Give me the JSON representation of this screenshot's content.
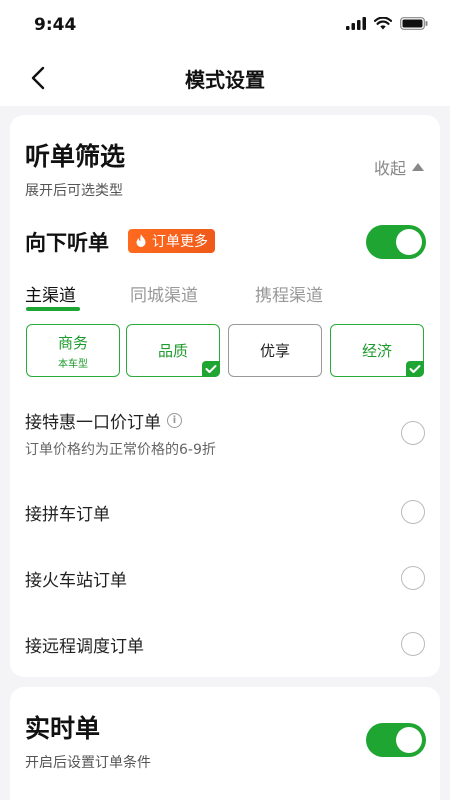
{
  "status": {
    "time": "9:44"
  },
  "nav": {
    "title": "模式设置"
  },
  "filter": {
    "title": "听单筛选",
    "subtitle": "展开后可选类型",
    "collapse_label": "收起"
  },
  "down_listen": {
    "title": "向下听单",
    "badge": "订单更多",
    "enabled": true
  },
  "tabs": [
    {
      "label": "主渠道",
      "active": true
    },
    {
      "label": "同城渠道",
      "active": false
    },
    {
      "label": "携程渠道",
      "active": false
    }
  ],
  "car_types": [
    {
      "label": "商务",
      "sub": "本车型",
      "selected": true,
      "checked": false
    },
    {
      "label": "品质",
      "sub": "",
      "selected": true,
      "checked": true
    },
    {
      "label": "优享",
      "sub": "",
      "selected": false,
      "checked": false
    },
    {
      "label": "经济",
      "sub": "",
      "selected": true,
      "checked": true
    }
  ],
  "options": [
    {
      "label": "接特惠一口价订单",
      "sub": "订单价格约为正常价格的6-9折",
      "info": "i"
    },
    {
      "label": "接拼车订单"
    },
    {
      "label": "接火车站订单"
    },
    {
      "label": "接远程调度订单"
    }
  ],
  "realtime": {
    "title": "实时单",
    "subtitle": "开启后设置订单条件",
    "enabled": true
  },
  "colors": {
    "accent": "#1fa531",
    "badge": "#f05a1a"
  }
}
